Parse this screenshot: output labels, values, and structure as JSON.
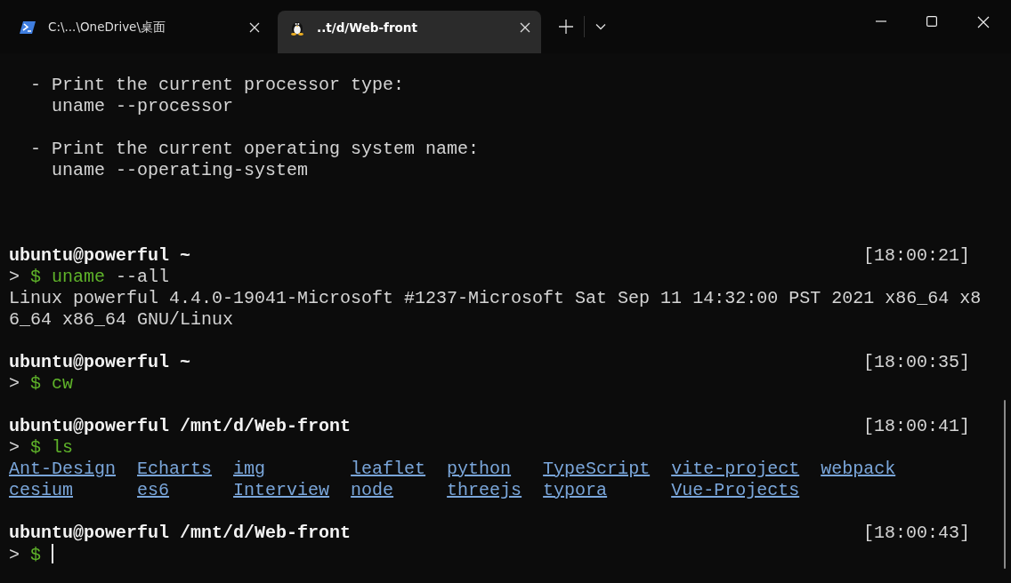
{
  "tabs": [
    {
      "title": "C:\\...\\OneDrive\\桌面",
      "kind": "powershell",
      "selected": false
    },
    {
      "title": "..t/d/Web-front",
      "kind": "linux",
      "selected": true
    }
  ],
  "terminal": {
    "lines": [
      {
        "kind": "text",
        "text": "  - Print the current processor type:"
      },
      {
        "kind": "text",
        "text": "    uname --processor"
      },
      {
        "kind": "blank"
      },
      {
        "kind": "text",
        "text": "  - Print the current operating system name:"
      },
      {
        "kind": "text",
        "text": "    uname --operating-system"
      },
      {
        "kind": "blank"
      },
      {
        "kind": "blank"
      },
      {
        "kind": "blank"
      },
      {
        "kind": "header",
        "text": "ubuntu@powerful ~",
        "time": "[18:00:21]"
      },
      {
        "kind": "command",
        "marker": ">",
        "symbol": "$",
        "command": "uname",
        "args": "--all"
      },
      {
        "kind": "text",
        "text": "Linux powerful 4.4.0-19041-Microsoft #1237-Microsoft Sat Sep 11 14:32:00 PST 2021 x86_64 x8"
      },
      {
        "kind": "text",
        "text": "6_64 x86_64 GNU/Linux"
      },
      {
        "kind": "blank"
      },
      {
        "kind": "header",
        "text": "ubuntu@powerful ~",
        "time": "[18:00:35]"
      },
      {
        "kind": "command",
        "marker": ">",
        "symbol": "$",
        "command": "cw"
      },
      {
        "kind": "blank"
      },
      {
        "kind": "header",
        "text": "ubuntu@powerful /mnt/d/Web-front",
        "time": "[18:00:41]"
      },
      {
        "kind": "command",
        "marker": ">",
        "symbol": "$",
        "command": "ls"
      },
      {
        "kind": "listing",
        "entries": [
          "Ant-Design",
          "cesium",
          "Echarts",
          "es6",
          "img",
          "Interview",
          "leaflet",
          "node",
          "python",
          "threejs",
          "TypeScript",
          "typora",
          "vite-project",
          "Vue-Projects",
          "webpack"
        ]
      },
      {
        "kind": "blank"
      },
      {
        "kind": "header",
        "text": "ubuntu@powerful /mnt/d/Web-front",
        "time": "[18:00:43]"
      },
      {
        "kind": "command",
        "marker": ">",
        "symbol": "$",
        "cursor": true
      }
    ]
  }
}
